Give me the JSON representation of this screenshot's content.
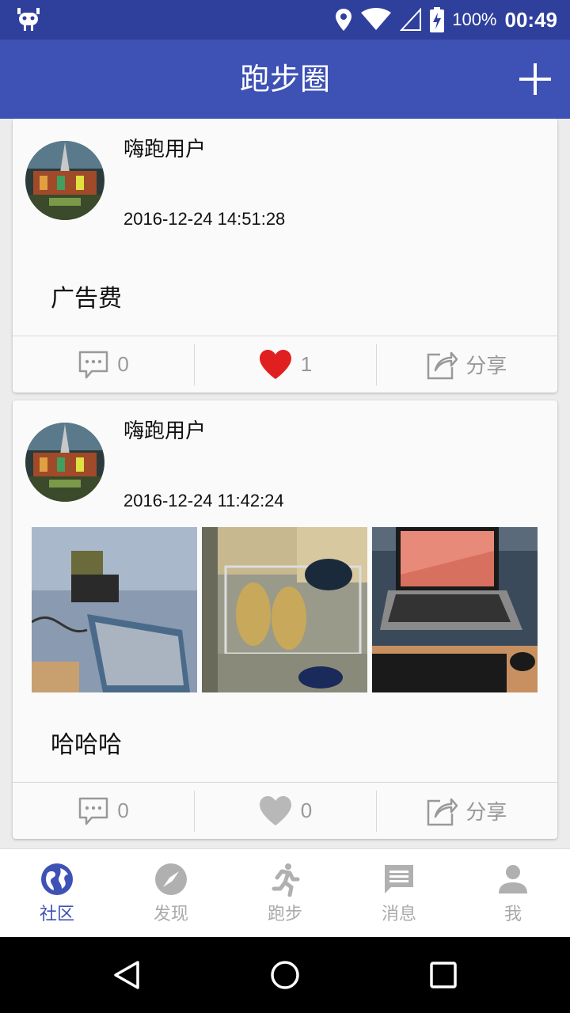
{
  "status_bar": {
    "battery": "100%",
    "time": "00:49"
  },
  "app_bar": {
    "title": "跑步圈"
  },
  "posts": [
    {
      "username": "嗨跑用户",
      "timestamp": "2016-12-24 14:51:28",
      "content": "广告费",
      "comments": "0",
      "likes": "1",
      "share": "分享"
    },
    {
      "username": "嗨跑用户",
      "timestamp": "2016-12-24 11:42:24",
      "content": "哈哈哈",
      "comments": "0",
      "likes": "0",
      "share": "分享"
    }
  ],
  "bottom_nav": [
    {
      "label": "社区"
    },
    {
      "label": "发现"
    },
    {
      "label": "跑步"
    },
    {
      "label": "消息"
    },
    {
      "label": "我"
    }
  ],
  "colors": {
    "primary": "#3e51b5",
    "status_bar": "#2f3f9c",
    "like_active": "#e02020"
  }
}
